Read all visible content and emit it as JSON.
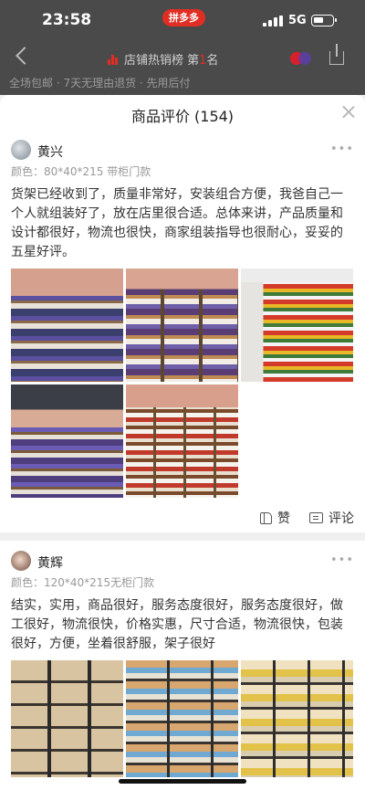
{
  "status_bar": {
    "time": "23:58",
    "app_badge": "拼多多",
    "network": "5G"
  },
  "background_page": {
    "rank_prefix": "店铺热销榜 第",
    "rank_number": "1",
    "rank_suffix": "名",
    "promo_text": "全场包邮 · 7天无理由退货 · 先用后付"
  },
  "sheet": {
    "title": "商品评价 (154)"
  },
  "reviews": [
    {
      "user": "黄兴",
      "spec": "颜色：80*40*215 带柜门款",
      "text": "货架已经收到了，质量非常好，安装组合方便，我爸自己一个人就组装好了，放在店里很合适。总体来讲，产品质量和设计都很好，物流也很快，商家组装指导也很耐心，妥妥的五星好评。",
      "photo_count": 5,
      "like_label": "赞",
      "comment_label": "评论"
    },
    {
      "user": "黄辉",
      "spec": "颜色：120*40*215无柜门款",
      "text": "结实，实用，商品很好，服务态度很好，服务态度很好，做工很好，物流很快，价格实惠，尺寸合适，物流很快，包装很好，方便，坐着很舒服，架子很好",
      "photo_count": 3
    }
  ],
  "colors": {
    "brand": "#e02e24",
    "sheet_bg": "#ffffff",
    "separator": "#f0f0f0",
    "secondary_text": "#999999"
  },
  "icons": [
    "back-icon",
    "rank-icon",
    "share-icon",
    "close-icon",
    "more-icon",
    "like-icon",
    "comment-icon"
  ]
}
